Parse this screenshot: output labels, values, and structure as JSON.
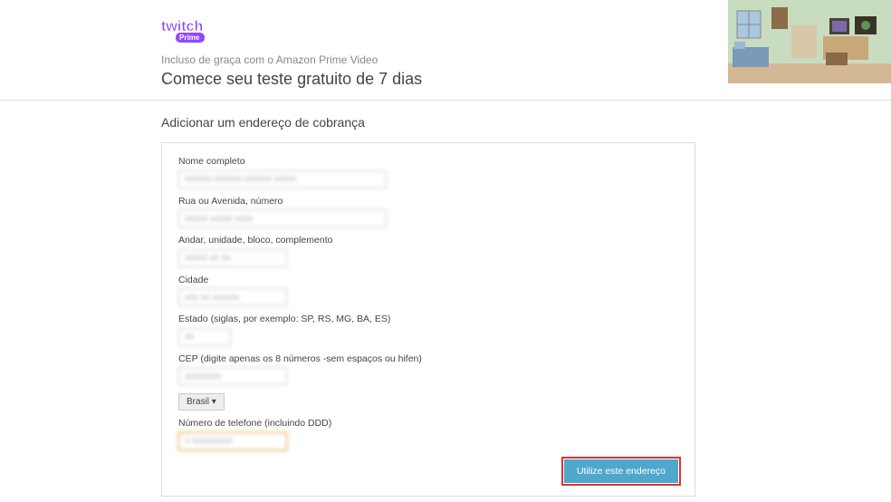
{
  "header": {
    "logo_text": "twitch",
    "logo_sub": "Prime",
    "subtitle": "Incluso de graça com o Amazon Prime Video",
    "title": "Comece seu teste gratuito de 7 dias"
  },
  "section": {
    "title": "Adicionar um endereço de cobrança"
  },
  "form": {
    "name": {
      "label": "Nome completo",
      "value": "xxxxxx xxxxxx xxxxxx xxxxx"
    },
    "street": {
      "label": "Rua ou Avenida, número",
      "value": "xxxxx xxxxx xxxx"
    },
    "complement": {
      "label": "Andar, unidade, bloco, complemento",
      "value": "xxxxx xx xx"
    },
    "city": {
      "label": "Cidade",
      "value": "xxx xx xxxxxx"
    },
    "state": {
      "label": "Estado (siglas, por exemplo: SP, RS, MG, BA, ES)",
      "value": "xx"
    },
    "cep": {
      "label": "CEP (digite apenas os 8 números -sem espaços ou hifen)",
      "value": "xxxxxxxx"
    },
    "country": {
      "label": "Brasil",
      "arrow": "▾"
    },
    "phone": {
      "label": "Número de telefone (incluindo DDD)",
      "value": "x xxxxxxxxx"
    },
    "submit": "Utilize este endereço"
  }
}
